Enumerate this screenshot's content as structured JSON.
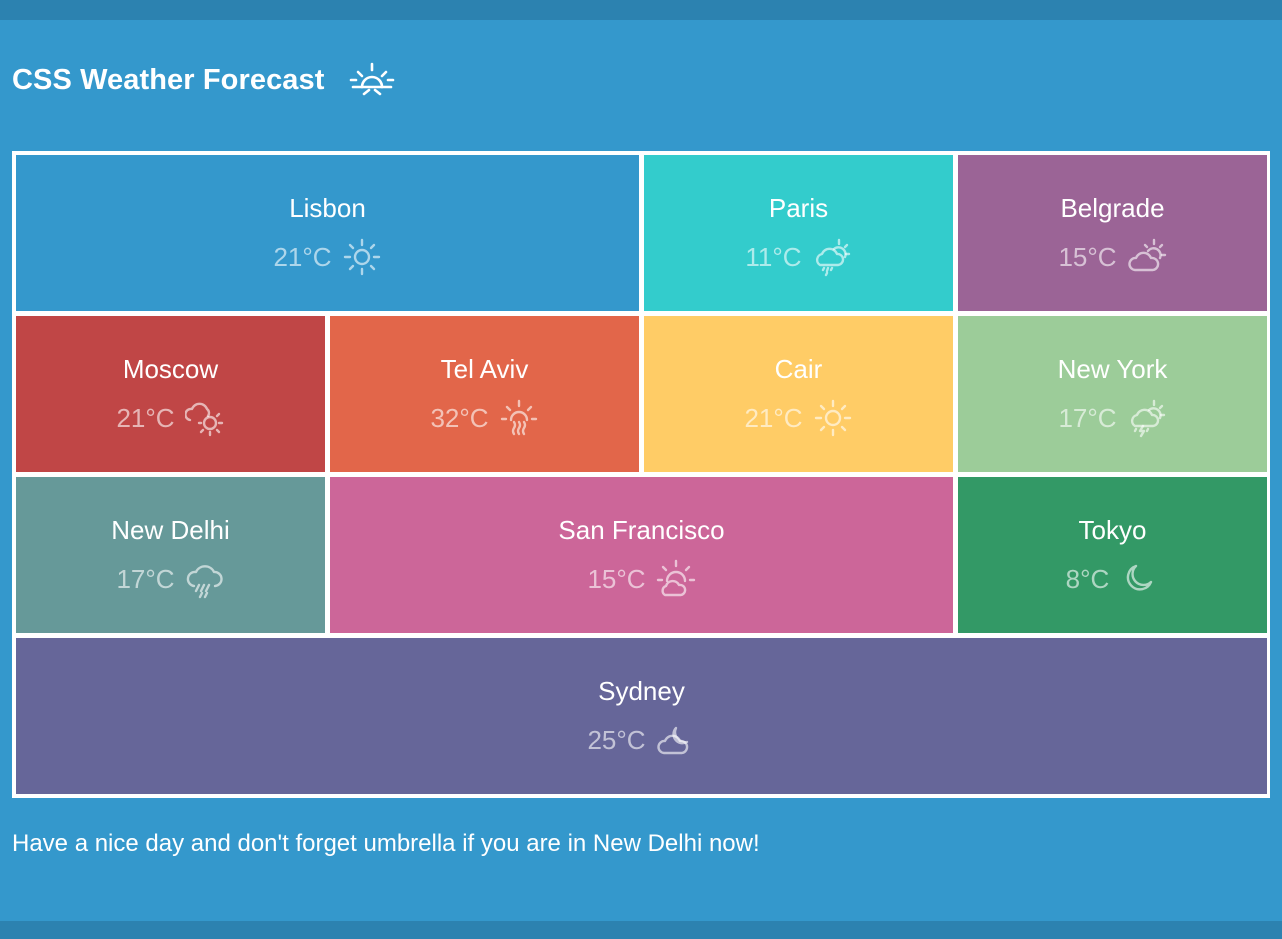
{
  "header": {
    "title": "CSS Weather Forecast",
    "icon": "sunrise-icon"
  },
  "cities": [
    {
      "name": "Lisbon",
      "temp": "21°C",
      "icon": "sun-icon",
      "color": "#3498cc"
    },
    {
      "name": "Paris",
      "temp": "11°C",
      "icon": "cloud-rain-sun-icon",
      "color": "#33cccc"
    },
    {
      "name": "Belgrade",
      "temp": "15°C",
      "icon": "cloud-sun-icon",
      "color": "#9b6496"
    },
    {
      "name": "Moscow",
      "temp": "21°C",
      "icon": "cloud-sun-low-icon",
      "color": "#c04646"
    },
    {
      "name": "Tel Aviv",
      "temp": "32°C",
      "icon": "sun-heat-icon",
      "color": "#e2664a"
    },
    {
      "name": "Cair",
      "temp": "21°C",
      "icon": "sun-icon",
      "color": "#ffcc66"
    },
    {
      "name": "New York",
      "temp": "17°C",
      "icon": "cloud-storm-sun-icon",
      "color": "#9ccc99"
    },
    {
      "name": "New Delhi",
      "temp": "17°C",
      "icon": "cloud-rain-icon",
      "color": "#669999"
    },
    {
      "name": "San Francisco",
      "temp": "15°C",
      "icon": "sun-behind-cloud-icon",
      "color": "#cc6699"
    },
    {
      "name": "Tokyo",
      "temp": "8°C",
      "icon": "moon-icon",
      "color": "#339966"
    },
    {
      "name": "Sydney",
      "temp": "25°C",
      "icon": "cloud-moon-icon",
      "color": "#666699"
    }
  ],
  "footer": {
    "text": "Have a nice day and don't forget umbrella if you are in New Delhi now!"
  }
}
